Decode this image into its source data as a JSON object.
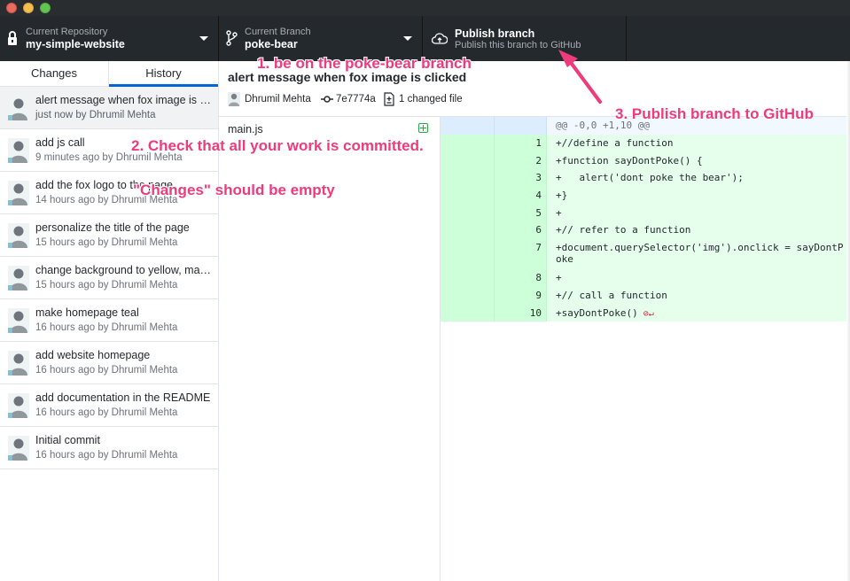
{
  "toolbar": {
    "repo": {
      "label": "Current Repository",
      "value": "my-simple-website"
    },
    "branch": {
      "label": "Current Branch",
      "value": "poke-bear"
    },
    "publish": {
      "title": "Publish branch",
      "subtitle": "Publish this branch to GitHub"
    }
  },
  "sidebar": {
    "tabs": [
      "Changes",
      "History"
    ],
    "active_tab": "History",
    "commits": [
      {
        "summary": "alert message when fox image is clicked",
        "meta": "just now by Dhrumil Mehta"
      },
      {
        "summary": "add js call",
        "meta": "9 minutes ago by Dhrumil Mehta"
      },
      {
        "summary": "add the fox logo to the page",
        "meta": "14 hours ago by Dhrumil Mehta"
      },
      {
        "summary": "personalize the title of the page",
        "meta": "15 hours ago by Dhrumil Mehta"
      },
      {
        "summary": "change background to yellow, make the header teal",
        "meta": "15 hours ago by Dhrumil Mehta"
      },
      {
        "summary": "make homepage teal",
        "meta": "16 hours ago by Dhrumil Mehta"
      },
      {
        "summary": "add website homepage",
        "meta": "16 hours ago by Dhrumil Mehta"
      },
      {
        "summary": "add documentation in the README",
        "meta": "16 hours ago by Dhrumil Mehta"
      },
      {
        "summary": "Initial commit",
        "meta": "16 hours ago by Dhrumil Mehta"
      }
    ]
  },
  "commit": {
    "title": "alert message when fox image is clicked",
    "author": "Dhrumil Mehta",
    "sha": "7e7774a",
    "files_changed": "1 changed file"
  },
  "files": [
    {
      "name": "main.js",
      "status": "added"
    }
  ],
  "diff": {
    "hunk": "@@ -0,0 +1,10 @@",
    "lines": [
      {
        "num": "1",
        "text": "+//define a function"
      },
      {
        "num": "2",
        "text": "+function sayDontPoke() {"
      },
      {
        "num": "3",
        "text": "+   alert('dont poke the bear');"
      },
      {
        "num": "4",
        "text": "+}"
      },
      {
        "num": "5",
        "text": "+"
      },
      {
        "num": "6",
        "text": "+// refer to a function"
      },
      {
        "num": "7",
        "text": "+document.querySelector('img').onclick = sayDontPoke"
      },
      {
        "num": "8",
        "text": "+"
      },
      {
        "num": "9",
        "text": "+// call a function"
      },
      {
        "num": "10",
        "text": "+sayDontPoke()"
      }
    ]
  },
  "annotations": {
    "step1": "1. be on the poke-bear branch",
    "step2": "2. Check that all your work is committed.",
    "step2b": "\"Changes\" should be empty",
    "step3": "3. Publish branch to GitHub"
  },
  "colors": {
    "toolbar_bg": "#24292e",
    "accent": "#0366d6",
    "annotation": "#ee3b7c",
    "diff_added_bg": "#e6ffed"
  }
}
